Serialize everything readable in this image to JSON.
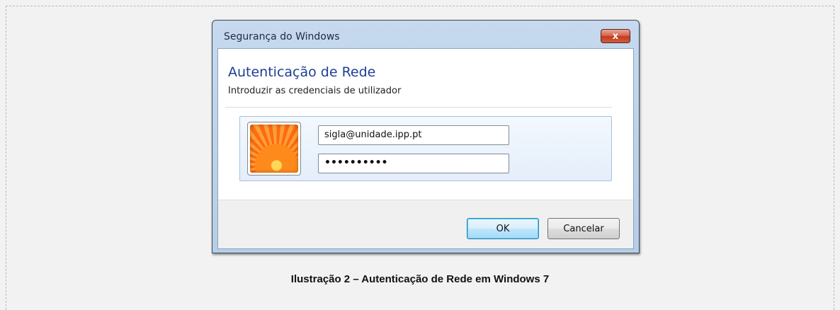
{
  "window": {
    "title": "Segurança do Windows",
    "close_label": "x"
  },
  "dialog": {
    "heading": "Autenticação de Rede",
    "subheading": "Introduzir as credenciais de utilizador"
  },
  "credentials": {
    "username_value": "sigla@unidade.ipp.pt",
    "password_value": "••••••••••"
  },
  "buttons": {
    "ok_label": "OK",
    "cancel_label": "Cancelar"
  },
  "caption": "Ilustração 2 – Autenticação de Rede em Windows 7"
}
